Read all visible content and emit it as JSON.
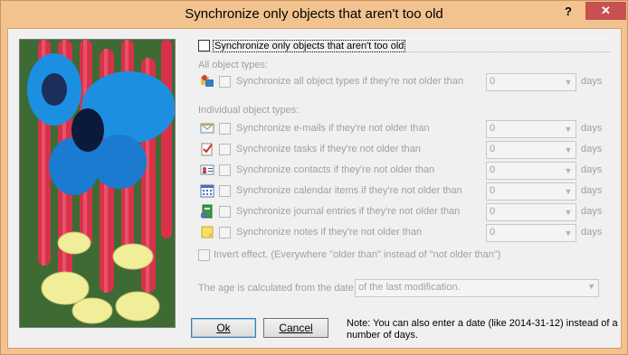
{
  "window": {
    "title": "Synchronize only objects that aren't too old",
    "help_glyph": "?",
    "close_glyph": "✕"
  },
  "main_option": {
    "label": "Synchronize only objects that aren't too old",
    "checked": false
  },
  "all_types": {
    "heading": "All object types:",
    "label": "Synchronize all object types if they're not older than",
    "value": "0",
    "unit": "days"
  },
  "individual": {
    "heading": "Individual object types:",
    "rows": [
      {
        "label": "Synchronize e-mails if they're not older than",
        "value": "0",
        "unit": "days",
        "icon": "email-icon"
      },
      {
        "label": "Synchronize tasks if they're not older than",
        "value": "0",
        "unit": "days",
        "icon": "task-icon"
      },
      {
        "label": "Synchronize contacts if they're not older than",
        "value": "0",
        "unit": "days",
        "icon": "contact-icon"
      },
      {
        "label": "Synchronize calendar items if they're not older than",
        "value": "0",
        "unit": "days",
        "icon": "calendar-icon"
      },
      {
        "label": "Synchronize journal entries if they're not older than",
        "value": "0",
        "unit": "days",
        "icon": "journal-icon"
      },
      {
        "label": "Synchronize notes if they're not older than",
        "value": "0",
        "unit": "days",
        "icon": "note-icon"
      }
    ]
  },
  "invert": {
    "label": "Invert effect. (Everywhere \"older than\" instead of \"not older than\")"
  },
  "age_basis": {
    "label": "The age is calculated from the date",
    "value": "of the last modification."
  },
  "buttons": {
    "ok": "Ok",
    "cancel": "Cancel"
  },
  "note": "Note: You can also enter a date (like 2014-31-12) instead of a number of days."
}
